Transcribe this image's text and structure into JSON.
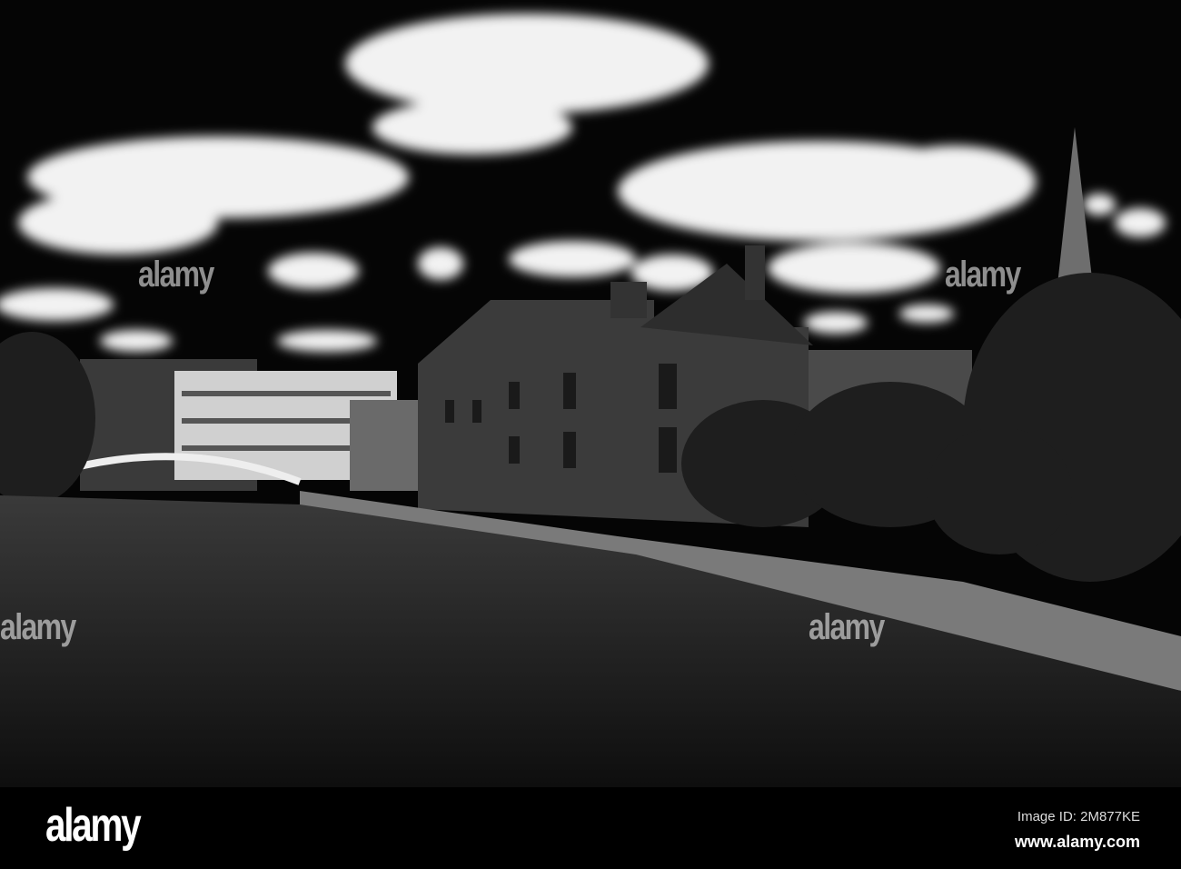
{
  "watermark": "alamy",
  "footer": {
    "logo": "alamy",
    "image_id": "Image ID: 2M877KE",
    "url": "www.alamy.com"
  }
}
